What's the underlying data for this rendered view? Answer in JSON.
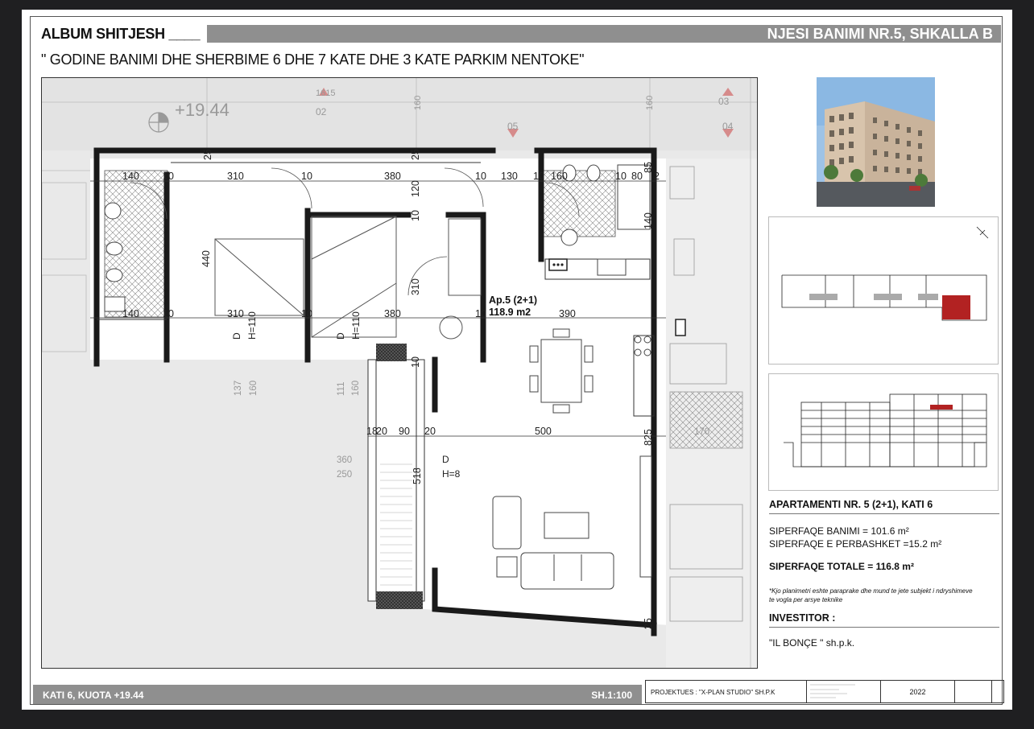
{
  "header": {
    "album": "ALBUM SHITJESH ____",
    "unit": "NJESI BANIMI NR.5, SHKALLA B",
    "subtitle": "\" GODINE BANIMI DHE SHERBIME 6 DHE 7 KATE DHE 3 KATE PARKIM NENTOKE\""
  },
  "plan": {
    "level_mark": "+19.44",
    "apt_name": "Ap.5 (2+1)",
    "apt_area": "118.9 m2",
    "dims_top": [
      "140",
      "10",
      "310",
      "10",
      "380",
      "10",
      "130",
      "10",
      "160",
      "10",
      "80",
      "2"
    ],
    "dims_vert": [
      "25",
      "25",
      "120",
      "10",
      "85",
      "140",
      "440",
      "310",
      "10",
      "825",
      "518",
      "25"
    ],
    "dims_mid": [
      "140",
      "10",
      "310",
      "10",
      "380",
      "10",
      "390"
    ],
    "dims_balcony": [
      "18",
      "20",
      "90",
      "20",
      "500"
    ],
    "small_dims": [
      "137",
      "160",
      "111",
      "160",
      "360",
      "250",
      "170",
      "02",
      "03",
      "04",
      "05",
      "1615",
      "160",
      "160"
    ],
    "window_d1": "D",
    "window_h1": "H=110",
    "window_d2": "D",
    "window_h2": "H=110",
    "window_d3": "D",
    "window_h3": "H=8"
  },
  "info": {
    "apartment_title": "APARTAMENTI NR. 5 (2+1), KATI 6",
    "area_living": "SIPERFAQE BANIMI = 101.6 m²",
    "area_common": "SIPERFAQE E PERBASHKET =15.2 m²",
    "area_total": "SIPERFAQE TOTALE = 116.8 m²",
    "note_line1": "*Kjo planimetri eshte paraprake dhe mund te jete subjekt i ndryshimeve",
    "note_line2": "te vogla per arsye teknike",
    "investor_label": "INVESTITOR :",
    "investor_name": "\"IL BONÇE \" sh.p.k."
  },
  "footer": {
    "floor": "KATI 6, KUOTA +19.44",
    "scale": "SH.1:100",
    "designer": "PROJEKTUES : \"X-PLAN STUDIO\" SH.P.K",
    "year": "2022"
  },
  "colors": {
    "band": "#8f8f8f",
    "highlight": "#b22222",
    "wall": "#1a1a1a"
  }
}
